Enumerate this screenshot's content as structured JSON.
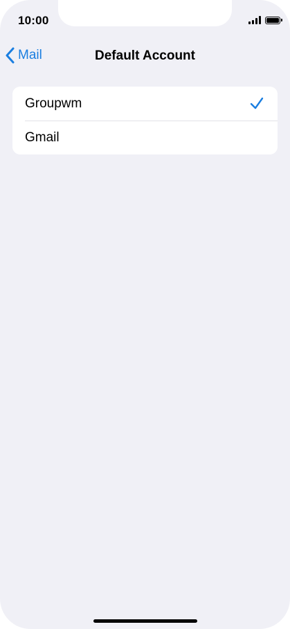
{
  "status_bar": {
    "time": "10:00"
  },
  "nav": {
    "back_label": "Mail",
    "title": "Default Account"
  },
  "accounts": [
    {
      "label": "Groupwm",
      "selected": true
    },
    {
      "label": "Gmail",
      "selected": false
    }
  ],
  "colors": {
    "accent": "#1a7ee0",
    "background": "#f0f0f6"
  },
  "icons": {
    "back": "chevron-left-icon",
    "selected": "checkmark-icon",
    "signal": "cellular-signal-icon",
    "battery": "battery-icon"
  }
}
